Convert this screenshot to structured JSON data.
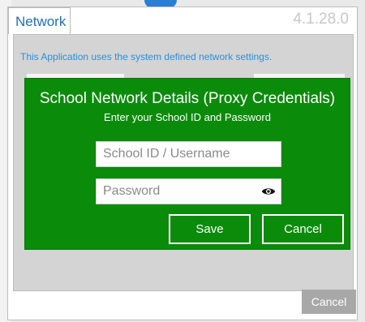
{
  "window": {
    "tab_label": "Network",
    "version": "4.1.28.0"
  },
  "panel": {
    "info_text": "This Application uses the system defined network settings."
  },
  "dialog": {
    "title": "School Network Details (Proxy Credentials)",
    "subtitle": "Enter your School ID and Password",
    "username_placeholder": "School ID / Username",
    "password_placeholder": "Password",
    "save_label": "Save",
    "cancel_label": "Cancel",
    "accent": "#0a8b0a"
  },
  "footer": {
    "cancel_label": "Cancel"
  },
  "icons": {
    "password_toggle": "eye-icon"
  }
}
